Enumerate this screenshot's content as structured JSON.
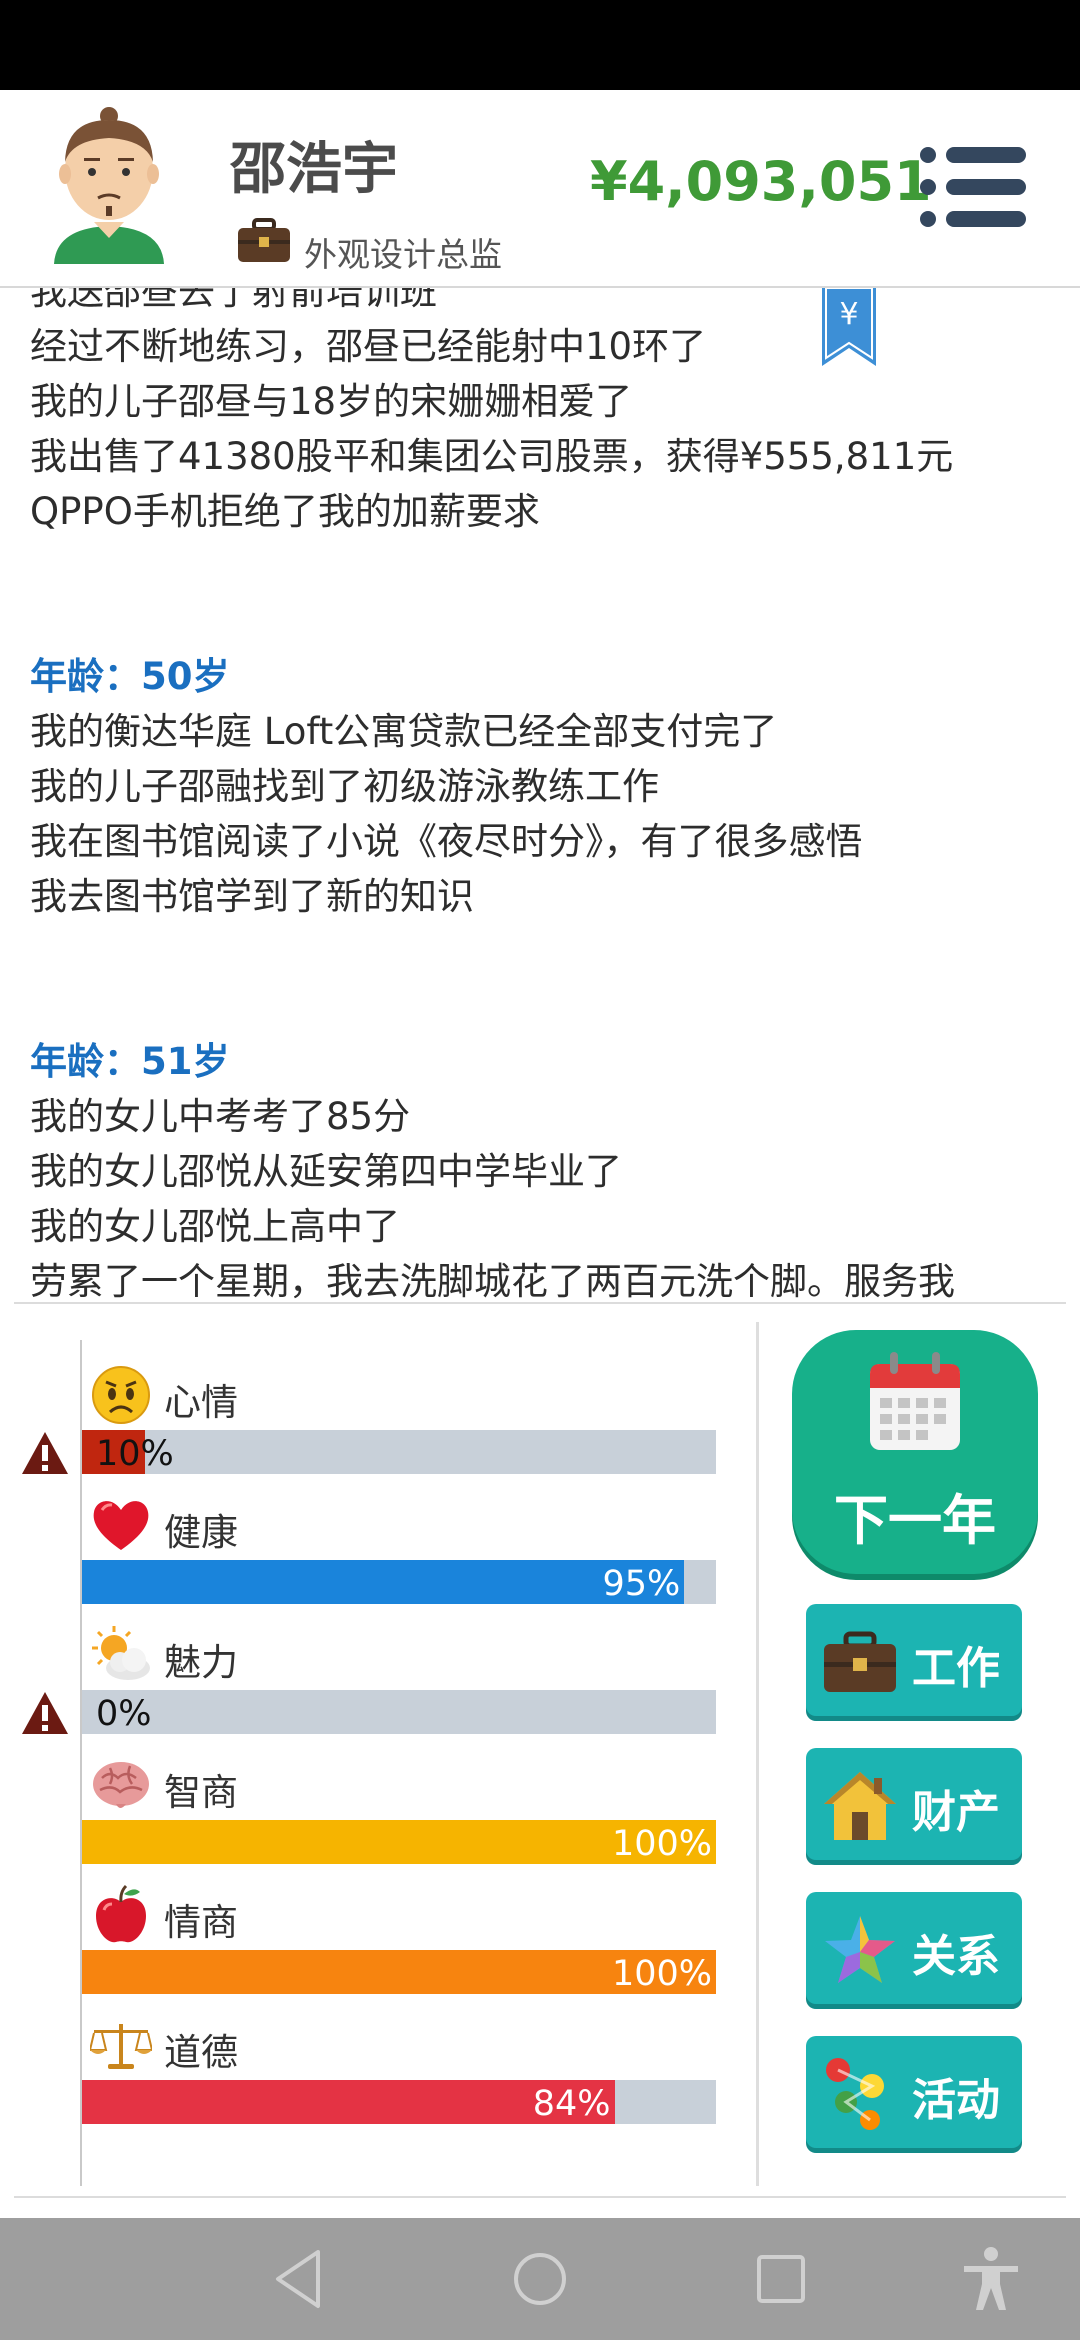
{
  "header": {
    "player_name": "邵浩宇",
    "job_title": "外观设计总监",
    "money": "¥4,093,051"
  },
  "log": {
    "lines": [
      {
        "type": "text",
        "text": "我送邵昼去了射箭培训班"
      },
      {
        "type": "text",
        "text": "经过不断地练习，邵昼已经能射中10环了"
      },
      {
        "type": "text",
        "text": "我的儿子邵昼与18岁的宋姗姗相爱了"
      },
      {
        "type": "text",
        "text": "我出售了41380股平和集团公司股票，获得¥555,811元"
      },
      {
        "type": "text",
        "text": "QPPO手机拒绝了我的加薪要求"
      },
      {
        "type": "gap"
      },
      {
        "type": "age",
        "text": "年龄：50岁"
      },
      {
        "type": "text",
        "text": "我的衡达华庭 Loft公寓贷款已经全部支付完了"
      },
      {
        "type": "text",
        "text": "我的儿子邵融找到了初级游泳教练工作"
      },
      {
        "type": "text",
        "text": "我在图书馆阅读了小说《夜尽时分》，有了很多感悟"
      },
      {
        "type": "text",
        "text": "我去图书馆学到了新的知识"
      },
      {
        "type": "gap"
      },
      {
        "type": "age",
        "text": "年龄：51岁"
      },
      {
        "type": "text",
        "text": "我的女儿中考考了85分"
      },
      {
        "type": "text",
        "text": "我的女儿邵悦从延安第四中学毕业了"
      },
      {
        "type": "text",
        "text": "我的女儿邵悦上高中了"
      },
      {
        "type": "text",
        "text": "劳累了一个星期，我去洗脚城花了两百元洗个脚。服务我"
      }
    ],
    "bookmark_symbol": "¥"
  },
  "stats": [
    {
      "key": "mood",
      "label": "心情",
      "value": 10,
      "pct_text": "10%",
      "color": "#c0260f",
      "warning": true,
      "icon": "sad-face-icon"
    },
    {
      "key": "health",
      "label": "健康",
      "value": 95,
      "pct_text": "95%",
      "color": "#1a84db",
      "warning": false,
      "icon": "heart-icon"
    },
    {
      "key": "charm",
      "label": "魅力",
      "value": 0,
      "pct_text": "0%",
      "color": "#d9a52a",
      "warning": true,
      "icon": "sun-cloud-icon"
    },
    {
      "key": "iq",
      "label": "智商",
      "value": 100,
      "pct_text": "100%",
      "color": "#f6b400",
      "warning": false,
      "icon": "brain-icon"
    },
    {
      "key": "eq",
      "label": "情商",
      "value": 100,
      "pct_text": "100%",
      "color": "#f7840f",
      "warning": false,
      "icon": "apple-icon"
    },
    {
      "key": "morality",
      "label": "道德",
      "value": 84,
      "pct_text": "84%",
      "color": "#e43344",
      "warning": false,
      "icon": "scales-icon"
    }
  ],
  "actions": {
    "next_year": "下一年",
    "work": "工作",
    "property": "财产",
    "relations": "关系",
    "activities": "活动"
  },
  "colors": {
    "money": "#3f9a37",
    "age_heading": "#1a6fc0",
    "next_year_bg": "#17b08a",
    "action_bg": "#1cb4b2",
    "bar_track": "#c8d0d9"
  }
}
